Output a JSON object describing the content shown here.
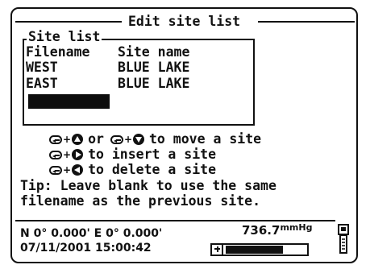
{
  "screen": {
    "title": "Edit site list"
  },
  "site_list": {
    "legend": "Site list",
    "columns": {
      "filename": "Filename",
      "site_name": "Site name"
    },
    "rows": [
      {
        "filename": "WEST",
        "site_name": "BLUE LAKE"
      },
      {
        "filename": "EAST",
        "site_name": "BLUE LAKE"
      }
    ],
    "selected_cell": ""
  },
  "instructions": {
    "move": {
      "keys": [
        "enter-icon",
        "up-arrow-icon",
        "down-arrow-icon"
      ],
      "joiner": "or",
      "text": "to move a site"
    },
    "insert": {
      "keys": [
        "enter-icon",
        "right-arrow-icon"
      ],
      "text": "to insert a site"
    },
    "delete": {
      "keys": [
        "enter-icon",
        "left-arrow-icon"
      ],
      "text": "to delete a site"
    }
  },
  "tip": {
    "line1": "Tip: Leave blank to use the same",
    "line2": "filename as the previous site."
  },
  "status": {
    "gps": "N 0° 0.000' E  0° 0.000'",
    "datetime": "07/11/2001 15:00:42",
    "pressure_value": "736.7",
    "pressure_unit": "mmHg",
    "battery_level": 0.72
  },
  "colors": {
    "foreground": "#111111",
    "background": "#ffffff"
  }
}
